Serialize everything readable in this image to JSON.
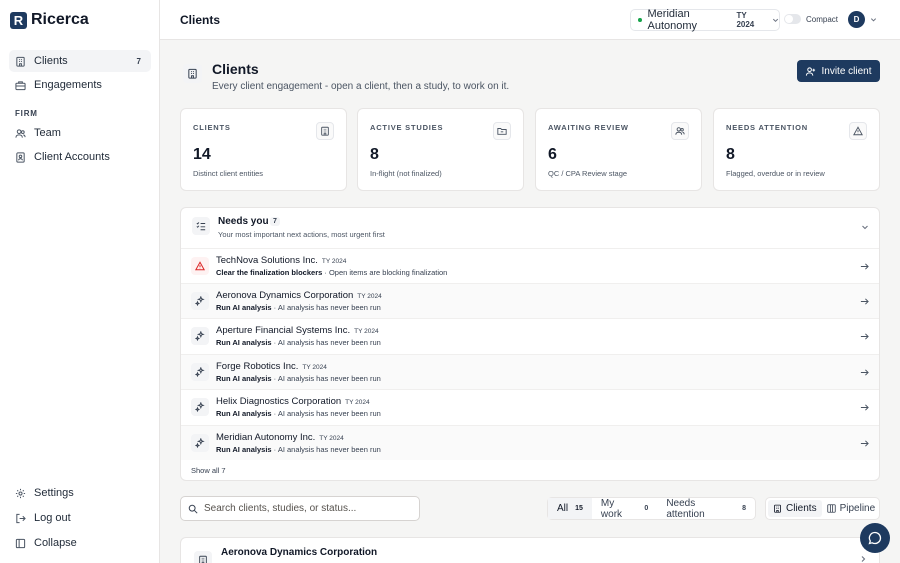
{
  "brand": {
    "mark": "R",
    "name": "Ricerca"
  },
  "sidebar": {
    "items": [
      {
        "label": "Clients",
        "count": "7"
      },
      {
        "label": "Engagements"
      }
    ],
    "section_heading": "FIRM",
    "firm_items": [
      {
        "label": "Team"
      },
      {
        "label": "Client Accounts"
      }
    ],
    "bottom_items": [
      {
        "label": "Settings"
      },
      {
        "label": "Log out"
      },
      {
        "label": "Collapse"
      }
    ]
  },
  "topbar": {
    "title": "Clients",
    "client_picker": {
      "name": "Meridian Autonomy",
      "tax_year": "TY 2024"
    },
    "compact_label": "Compact",
    "avatar_initial": "D"
  },
  "header": {
    "title": "Clients",
    "subtitle": "Every client engagement - open a client, then a study, to work on it.",
    "invite_label": "Invite client"
  },
  "stats": [
    {
      "label": "CLIENTS",
      "value": "14",
      "desc": "Distinct client entities"
    },
    {
      "label": "ACTIVE STUDIES",
      "value": "8",
      "desc": "In-flight (not finalized)"
    },
    {
      "label": "AWAITING REVIEW",
      "value": "6",
      "desc": "QC / CPA Review stage"
    },
    {
      "label": "NEEDS ATTENTION",
      "value": "8",
      "desc": "Flagged, overdue or in review"
    }
  ],
  "needs_you": {
    "title": "Needs you",
    "count": "7",
    "subtitle": "Your most important next actions, most urgent first",
    "rows": [
      {
        "name": "TechNova Solutions Inc.",
        "ty": "TY 2024",
        "action": "Clear the finalization blockers",
        "detail": " · Open items are blocking finalization"
      },
      {
        "name": "Aeronova Dynamics Corporation",
        "ty": "TY 2024",
        "action": "Run AI analysis",
        "detail": " · AI analysis has never been run"
      },
      {
        "name": "Aperture Financial Systems Inc.",
        "ty": "TY 2024",
        "action": "Run AI analysis",
        "detail": " · AI analysis has never been run"
      },
      {
        "name": "Forge Robotics Inc.",
        "ty": "TY 2024",
        "action": "Run AI analysis",
        "detail": " · AI analysis has never been run"
      },
      {
        "name": "Helix Diagnostics Corporation",
        "ty": "TY 2024",
        "action": "Run AI analysis",
        "detail": " · AI analysis has never been run"
      },
      {
        "name": "Meridian Autonomy Inc.",
        "ty": "TY 2024",
        "action": "Run AI analysis",
        "detail": " · AI analysis has never been run"
      }
    ],
    "show_all": "Show all 7"
  },
  "search": {
    "placeholder": "Search clients, studies, or status..."
  },
  "filters": [
    {
      "label": "All",
      "count": "15"
    },
    {
      "label": "My work",
      "count": "0"
    },
    {
      "label": "Needs attention",
      "count": "8"
    }
  ],
  "views": [
    {
      "label": "Clients"
    },
    {
      "label": "Pipeline"
    }
  ],
  "client_list": [
    {
      "name": "Aeronova Dynamics Corporation"
    }
  ]
}
